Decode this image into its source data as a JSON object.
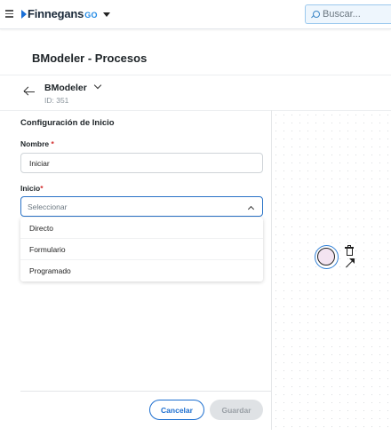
{
  "topbar": {
    "brand": "Finnegans",
    "brand_suffix": "GO",
    "search_placeholder": "Buscar..."
  },
  "page": {
    "title": "BModeler - Procesos"
  },
  "entity": {
    "name": "BModeler",
    "id_label": "ID: 351"
  },
  "form": {
    "panel_title": "Configuración de Inicio",
    "name_label": "Nombre",
    "name_required_mark": "*",
    "name_value": "Iniciar",
    "start_label": "Inicio",
    "start_required_mark": "*",
    "start_placeholder": "Seleccionar",
    "start_options": [
      "Directo",
      "Formulario",
      "Programado"
    ]
  },
  "actions": {
    "cancel_label": "Cancelar",
    "save_label": "Guardar"
  },
  "colors": {
    "accent": "#1d6fd0",
    "required": "#d32f2f",
    "start_event_fill": "#f3e4f1"
  },
  "icons": [
    "menu-icon",
    "search-icon",
    "back-arrow-icon",
    "chevron-down-icon",
    "chevron-up-icon",
    "trash-icon",
    "connect-arrow-icon"
  ]
}
